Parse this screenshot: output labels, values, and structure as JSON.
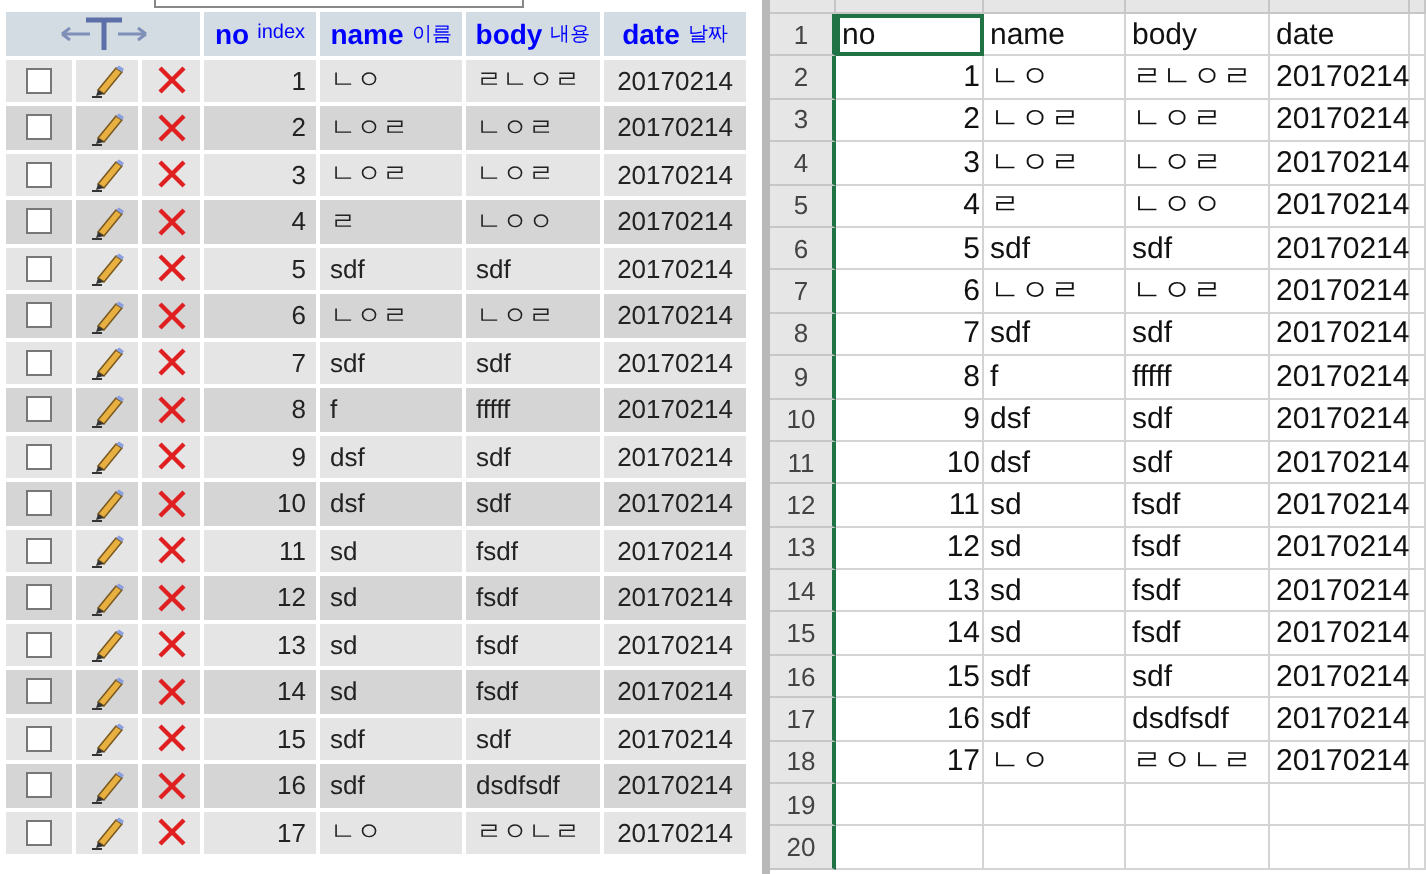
{
  "db_table": {
    "columns": [
      {
        "label": "no",
        "sub": "index"
      },
      {
        "label": "name",
        "sub": "이름"
      },
      {
        "label": "body",
        "sub": "내용"
      },
      {
        "label": "date",
        "sub": "날짜"
      }
    ],
    "rows": [
      {
        "no": "1",
        "name": "ㄴㅇ",
        "body": "ㄹㄴㅇㄹ",
        "date": "20170214",
        "checked": false
      },
      {
        "no": "2",
        "name": "ㄴㅇㄹ",
        "body": "ㄴㅇㄹ",
        "date": "20170214",
        "checked": false
      },
      {
        "no": "3",
        "name": "ㄴㅇㄹ",
        "body": "ㄴㅇㄹ",
        "date": "20170214",
        "checked": false
      },
      {
        "no": "4",
        "name": "ㄹ",
        "body": "ㄴㅇㅇ",
        "date": "20170214",
        "checked": false
      },
      {
        "no": "5",
        "name": "sdf",
        "body": "sdf",
        "date": "20170214",
        "checked": false
      },
      {
        "no": "6",
        "name": "ㄴㅇㄹ",
        "body": "ㄴㅇㄹ",
        "date": "20170214",
        "checked": false
      },
      {
        "no": "7",
        "name": "sdf",
        "body": "sdf",
        "date": "20170214",
        "checked": false
      },
      {
        "no": "8",
        "name": "f",
        "body": "fffff",
        "date": "20170214",
        "checked": false
      },
      {
        "no": "9",
        "name": "dsf",
        "body": "sdf",
        "date": "20170214",
        "checked": false
      },
      {
        "no": "10",
        "name": "dsf",
        "body": "sdf",
        "date": "20170214",
        "checked": false
      },
      {
        "no": "11",
        "name": "sd",
        "body": "fsdf",
        "date": "20170214",
        "checked": false
      },
      {
        "no": "12",
        "name": "sd",
        "body": "fsdf",
        "date": "20170214",
        "checked": false
      },
      {
        "no": "13",
        "name": "sd",
        "body": "fsdf",
        "date": "20170214",
        "checked": false
      },
      {
        "no": "14",
        "name": "sd",
        "body": "fsdf",
        "date": "20170214",
        "checked": false
      },
      {
        "no": "15",
        "name": "sdf",
        "body": "sdf",
        "date": "20170214",
        "checked": false
      },
      {
        "no": "16",
        "name": "sdf",
        "body": "dsdfsdf",
        "date": "20170214",
        "checked": false
      },
      {
        "no": "17",
        "name": "ㄴㅇ",
        "body": "ㄹㅇㄴㄹ",
        "date": "20170214",
        "checked": false
      }
    ]
  },
  "spreadsheet": {
    "rows": [
      {
        "number": "1",
        "cells": [
          {
            "text": "no",
            "selected": true
          },
          {
            "text": "name",
            "selected": false
          },
          {
            "text": "body",
            "selected": false
          },
          {
            "text": "date",
            "selected": false
          }
        ]
      },
      {
        "number": "2",
        "cells": [
          {
            "text": "1",
            "selected": false
          },
          {
            "text": "ㄴㅇ",
            "selected": false
          },
          {
            "text": "ㄹㄴㅇㄹ",
            "selected": false
          },
          {
            "text": "20170214",
            "selected": false
          }
        ]
      },
      {
        "number": "3",
        "cells": [
          {
            "text": "2",
            "selected": false
          },
          {
            "text": "ㄴㅇㄹ",
            "selected": false
          },
          {
            "text": "ㄴㅇㄹ",
            "selected": false
          },
          {
            "text": "20170214",
            "selected": false
          }
        ]
      },
      {
        "number": "4",
        "cells": [
          {
            "text": "3",
            "selected": false
          },
          {
            "text": "ㄴㅇㄹ",
            "selected": false
          },
          {
            "text": "ㄴㅇㄹ",
            "selected": false
          },
          {
            "text": "20170214",
            "selected": false
          }
        ]
      },
      {
        "number": "5",
        "cells": [
          {
            "text": "4",
            "selected": false
          },
          {
            "text": "ㄹ",
            "selected": false
          },
          {
            "text": "ㄴㅇㅇ",
            "selected": false
          },
          {
            "text": "20170214",
            "selected": false
          }
        ]
      },
      {
        "number": "6",
        "cells": [
          {
            "text": "5",
            "selected": false
          },
          {
            "text": "sdf",
            "selected": false
          },
          {
            "text": "sdf",
            "selected": false
          },
          {
            "text": "20170214",
            "selected": false
          }
        ]
      },
      {
        "number": "7",
        "cells": [
          {
            "text": "6",
            "selected": false
          },
          {
            "text": "ㄴㅇㄹ",
            "selected": false
          },
          {
            "text": "ㄴㅇㄹ",
            "selected": false
          },
          {
            "text": "20170214",
            "selected": false
          }
        ]
      },
      {
        "number": "8",
        "cells": [
          {
            "text": "7",
            "selected": false
          },
          {
            "text": "sdf",
            "selected": false
          },
          {
            "text": "sdf",
            "selected": false
          },
          {
            "text": "20170214",
            "selected": false
          }
        ]
      },
      {
        "number": "9",
        "cells": [
          {
            "text": "8",
            "selected": false
          },
          {
            "text": "f",
            "selected": false
          },
          {
            "text": "fffff",
            "selected": false
          },
          {
            "text": "20170214",
            "selected": false
          }
        ]
      },
      {
        "number": "10",
        "cells": [
          {
            "text": "9",
            "selected": false
          },
          {
            "text": "dsf",
            "selected": false
          },
          {
            "text": "sdf",
            "selected": false
          },
          {
            "text": "20170214",
            "selected": false
          }
        ]
      },
      {
        "number": "11",
        "cells": [
          {
            "text": "10",
            "selected": false
          },
          {
            "text": "dsf",
            "selected": false
          },
          {
            "text": "sdf",
            "selected": false
          },
          {
            "text": "20170214",
            "selected": false
          }
        ]
      },
      {
        "number": "12",
        "cells": [
          {
            "text": "11",
            "selected": false
          },
          {
            "text": "sd",
            "selected": false
          },
          {
            "text": "fsdf",
            "selected": false
          },
          {
            "text": "20170214",
            "selected": false
          }
        ]
      },
      {
        "number": "13",
        "cells": [
          {
            "text": "12",
            "selected": false
          },
          {
            "text": "sd",
            "selected": false
          },
          {
            "text": "fsdf",
            "selected": false
          },
          {
            "text": "20170214",
            "selected": false
          }
        ]
      },
      {
        "number": "14",
        "cells": [
          {
            "text": "13",
            "selected": false
          },
          {
            "text": "sd",
            "selected": false
          },
          {
            "text": "fsdf",
            "selected": false
          },
          {
            "text": "20170214",
            "selected": false
          }
        ]
      },
      {
        "number": "15",
        "cells": [
          {
            "text": "14",
            "selected": false
          },
          {
            "text": "sd",
            "selected": false
          },
          {
            "text": "fsdf",
            "selected": false
          },
          {
            "text": "20170214",
            "selected": false
          }
        ]
      },
      {
        "number": "16",
        "cells": [
          {
            "text": "15",
            "selected": false
          },
          {
            "text": "sdf",
            "selected": false
          },
          {
            "text": "sdf",
            "selected": false
          },
          {
            "text": "20170214",
            "selected": false
          }
        ]
      },
      {
        "number": "17",
        "cells": [
          {
            "text": "16",
            "selected": false
          },
          {
            "text": "sdf",
            "selected": false
          },
          {
            "text": "dsdfsdf",
            "selected": false
          },
          {
            "text": "20170214",
            "selected": false
          }
        ]
      },
      {
        "number": "18",
        "cells": [
          {
            "text": "17",
            "selected": false
          },
          {
            "text": "ㄴㅇ",
            "selected": false
          },
          {
            "text": "ㄹㅇㄴㄹ",
            "selected": false
          },
          {
            "text": "20170214",
            "selected": false
          }
        ]
      },
      {
        "number": "19",
        "cells": []
      },
      {
        "number": "20",
        "cells": []
      }
    ]
  }
}
